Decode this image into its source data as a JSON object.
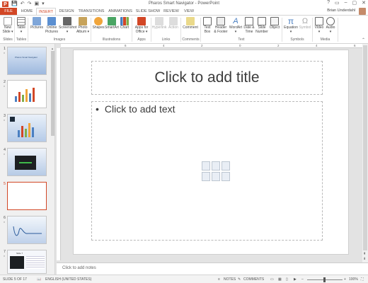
{
  "window": {
    "title": "Pharos Smart Navigator - PowerPoint",
    "controls": [
      "?",
      "▭",
      "–",
      "▢",
      "✕"
    ]
  },
  "qat": {
    "logo": "P",
    "items": [
      "💾",
      "↶",
      "↷",
      "▣",
      "▾"
    ]
  },
  "tabs": [
    "FILE",
    "HOME",
    "INSERT",
    "DESIGN",
    "TRANSITIONS",
    "ANIMATIONS",
    "SLIDE SHOW",
    "REVIEW",
    "VIEW"
  ],
  "user": "Brian Underdahl",
  "ribbon": {
    "buttons": [
      {
        "label": "New\nSlide ▾"
      },
      {
        "label": "Table\n▾"
      },
      {
        "label": "Pictures"
      },
      {
        "label": "Online\nPictures"
      },
      {
        "label": "Screenshot\n▾"
      },
      {
        "label": "Photo\nAlbum ▾"
      },
      {
        "label": "Shapes"
      },
      {
        "label": "SmartArt"
      },
      {
        "label": "Chart"
      },
      {
        "label": "Apps for\nOffice ▾"
      },
      {
        "label": "Hyperlink"
      },
      {
        "label": "Action"
      },
      {
        "label": "Comment"
      },
      {
        "label": "Text\nBox"
      },
      {
        "label": "Header\n& Footer"
      },
      {
        "label": "WordArt\n▾"
      },
      {
        "label": "Date &\nTime"
      },
      {
        "label": "Slide\nNumber"
      },
      {
        "label": "Object"
      },
      {
        "label": "Equation\n▾"
      },
      {
        "label": "Symbol"
      },
      {
        "label": "Video\n▾"
      },
      {
        "label": "Audio\n▾"
      }
    ],
    "groups": [
      "Slides",
      "Tables",
      "Images",
      "Illustrations",
      "Apps",
      "Links",
      "Comments",
      "Text",
      "Symbols",
      "Media"
    ]
  },
  "thumbnails": [
    {
      "num": "1",
      "star": "*",
      "caption": "Pharos Smart Navigator"
    },
    {
      "num": "2",
      "star": "*",
      "caption": ""
    },
    {
      "num": "3",
      "star": "*",
      "caption": ""
    },
    {
      "num": "4",
      "star": "*",
      "caption": ""
    },
    {
      "num": "5",
      "star": "",
      "caption": ""
    },
    {
      "num": "6",
      "star": "*",
      "caption": ""
    },
    {
      "num": "7",
      "star": "*",
      "caption": "Slide 7"
    }
  ],
  "ruler_labels": [
    "6",
    "4",
    "2",
    "0",
    "2",
    "4",
    "6"
  ],
  "slide": {
    "title_placeholder": "Click to add title",
    "body_placeholder": "Click to add text",
    "bullet": "•"
  },
  "notes_placeholder": "Click to add notes",
  "status": {
    "slide": "SLIDE 5 OF 17",
    "language": "ENGLISH (UNITED STATES)",
    "notes": "NOTES",
    "comments": "COMMENTS",
    "zoom": "100%"
  },
  "colors": {
    "accent": "#d24726",
    "ribbon_bg": "#ffffff",
    "work_bg": "#e3e3e3"
  }
}
